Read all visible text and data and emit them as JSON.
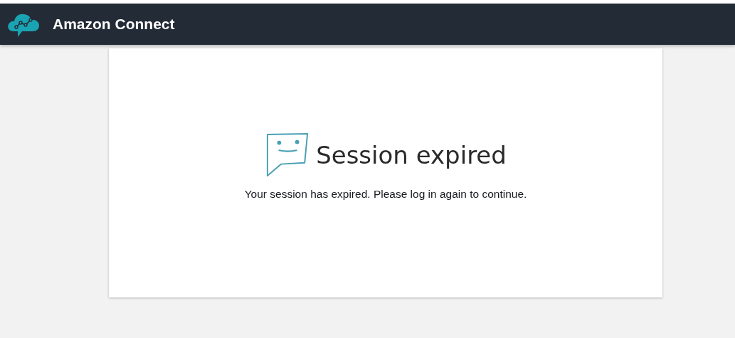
{
  "header": {
    "title": "Amazon Connect"
  },
  "message": {
    "title": "Session expired",
    "text": "Your session has expired. Please log in again to continue."
  }
}
